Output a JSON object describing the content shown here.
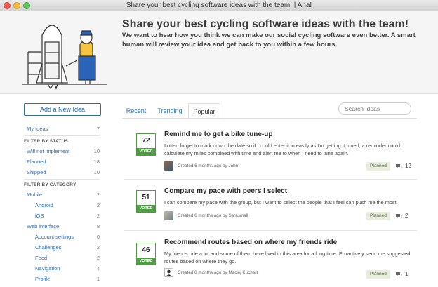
{
  "window": {
    "title": "Share your best cycling software ideas with the team! | Aha!"
  },
  "hero": {
    "heading": "Share your best cycling software ideas with the team!",
    "subtext": "We want to hear how you think we can make our social cycling software even better. A smart human will review your idea and get back to you within a few hours."
  },
  "sidebar": {
    "add_button": "Add a New Idea",
    "my_ideas": {
      "label": "My Ideas",
      "count": "7"
    },
    "status_heading": "FILTER BY STATUS",
    "statuses": [
      {
        "label": "Will not implement",
        "count": "10"
      },
      {
        "label": "Planned",
        "count": "18"
      },
      {
        "label": "Shipped",
        "count": "10"
      }
    ],
    "category_heading": "FILTER BY CATEGORY",
    "categories": [
      {
        "label": "Mobile",
        "count": "2",
        "indent": false
      },
      {
        "label": "Android",
        "count": "2",
        "indent": true
      },
      {
        "label": "iOS",
        "count": "2",
        "indent": true
      },
      {
        "label": "Web interface",
        "count": "8",
        "indent": false
      },
      {
        "label": "Account settings",
        "count": "0",
        "indent": true
      },
      {
        "label": "Challenges",
        "count": "2",
        "indent": true
      },
      {
        "label": "Feed",
        "count": "2",
        "indent": true
      },
      {
        "label": "Navigation",
        "count": "4",
        "indent": true
      },
      {
        "label": "Profile",
        "count": "1",
        "indent": true
      }
    ]
  },
  "tabs": [
    {
      "label": "Recent",
      "active": false
    },
    {
      "label": "Trending",
      "active": false
    },
    {
      "label": "Popular",
      "active": true
    }
  ],
  "search": {
    "placeholder": "Search Ideas"
  },
  "ideas": [
    {
      "votes": "72",
      "vote_label": "VOTED",
      "title": "Remind me to get a bike tune-up",
      "description": "I often forget to mark down the date so if i could enter it in easily as I'm getting it tuned, a reminder could calculate my miles combined with time and alert me to when I need to tune again.",
      "meta": "Created 6 months ago by John",
      "status": "Planned",
      "comments": "12"
    },
    {
      "votes": "51",
      "vote_label": "VOTED",
      "title": "Compare my pace with peers I select",
      "description": "I can compare my pace with the group, but I want to select the people that I feel can push me the most.",
      "meta": "Created 6 months ago by Sarasmall",
      "status": "Planned",
      "comments": "2"
    },
    {
      "votes": "46",
      "vote_label": "VOTED",
      "title": "Recommend routes based on where my friends ride",
      "description": "My friends ride a lot and some of them have lived in this area for a long time. Proactively send me suggested routes based on where they go.",
      "meta": "Created 8 months ago by Maciej Kucharz",
      "status": "Planned",
      "comments": "1"
    }
  ],
  "colors": {
    "link": "#2d6fb4",
    "voted_green": "#4f9d42",
    "planned_bg": "#e8eddd"
  }
}
